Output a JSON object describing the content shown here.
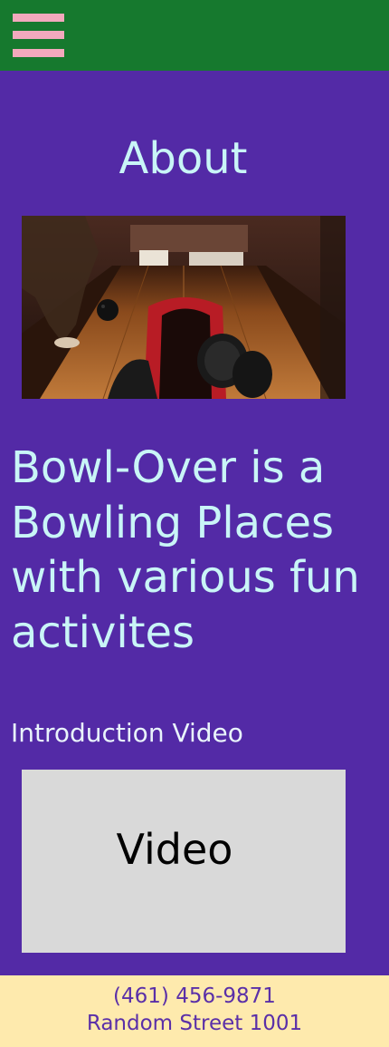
{
  "header": {
    "menu_icon": "hamburger-menu-icon",
    "background": "#16792e",
    "menu_color": "#f3a9bd"
  },
  "main": {
    "title": "About",
    "tagline": "Bowl-Over is a Bowling Places with various fun activites",
    "video_heading": "Introduction Video",
    "video_placeholder": "Video",
    "background": "#532aa6",
    "text_color": "#c9f5f7"
  },
  "footer": {
    "phone": "(461) 456-9871",
    "address": "Random Street 1001",
    "background": "#feeaad",
    "text_color": "#5a2fa8"
  }
}
